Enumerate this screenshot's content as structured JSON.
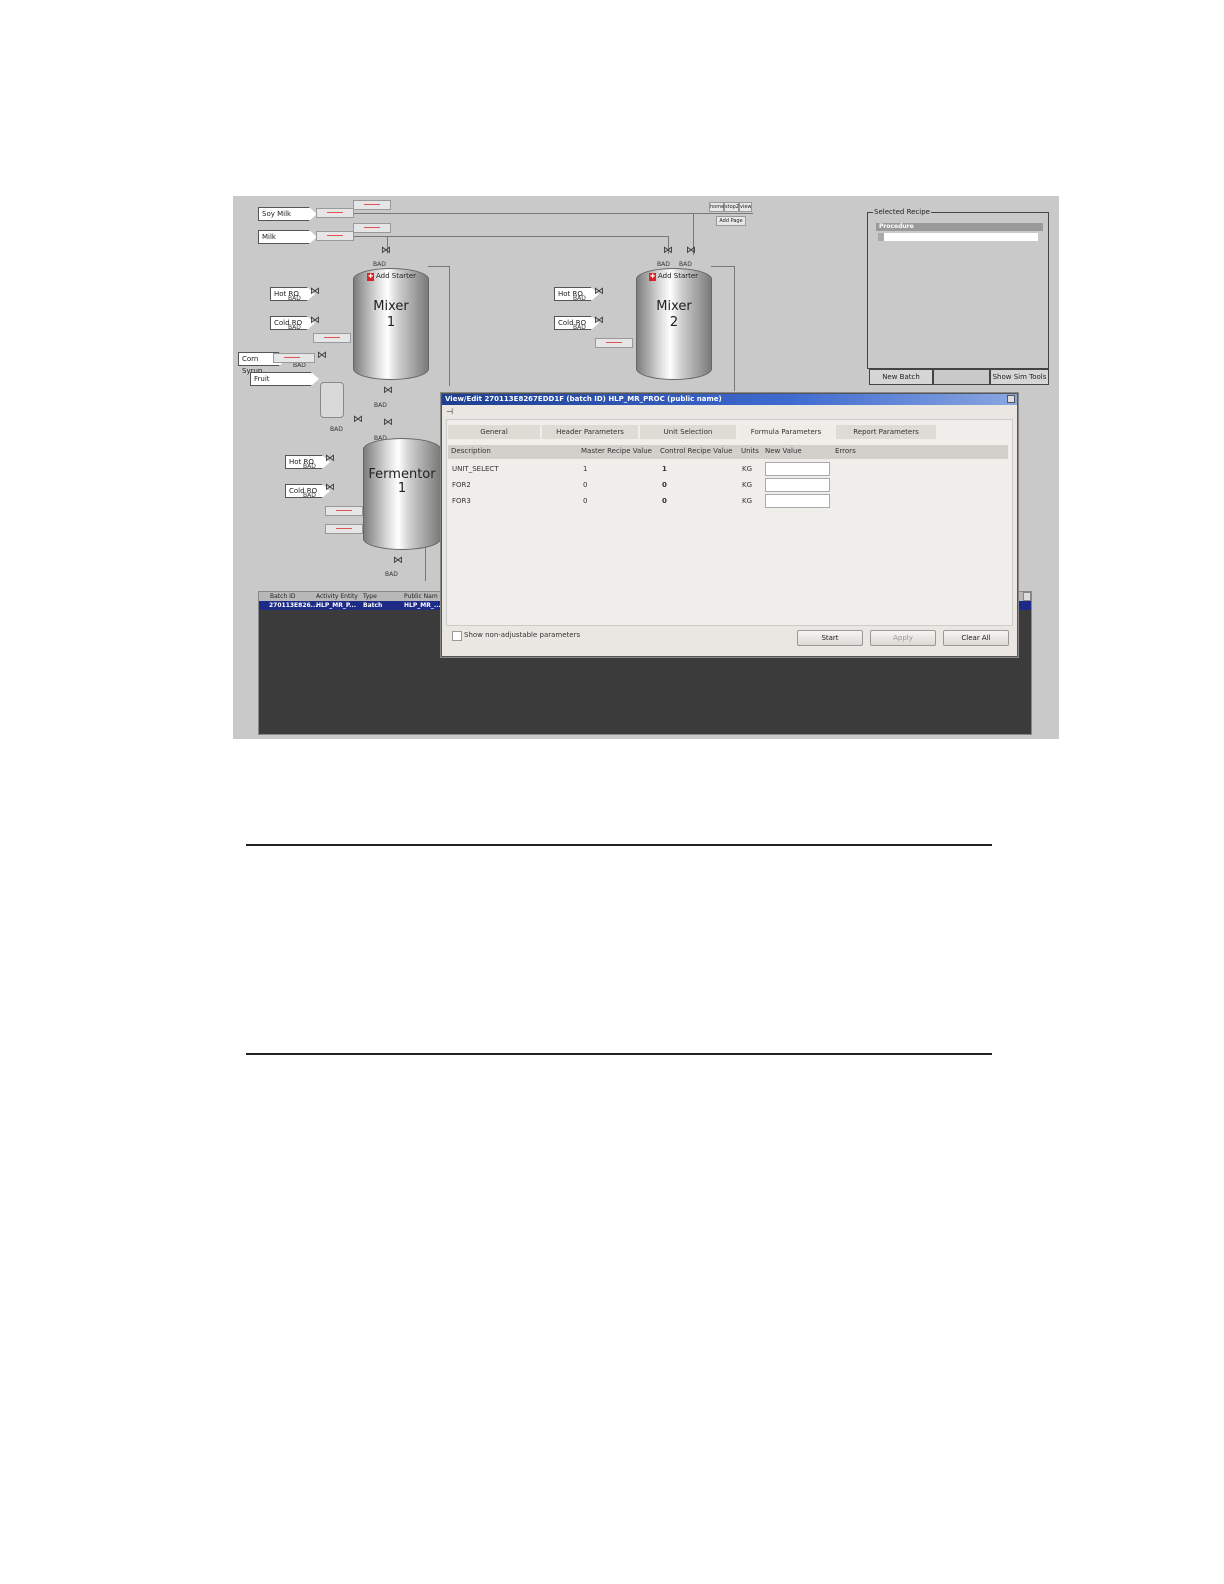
{
  "inputs": {
    "soy_milk": "Soy Milk",
    "milk": "Milk",
    "hot_ro": "Hot RO",
    "cold_ro": "Cold RO",
    "corn_syrup": "Corn Syrup",
    "fruit": "Fruit"
  },
  "status_bad": "BAD",
  "tanks": {
    "mixer1": [
      "Mixer",
      "1"
    ],
    "mixer2": [
      "Mixer",
      "2"
    ],
    "fermentor1": [
      "Fermentor",
      "1"
    ]
  },
  "add_starter": "Add Starter",
  "mini_buttons": [
    "home",
    "stop2",
    "view"
  ],
  "add_page": "Add Page",
  "selected_recipe": {
    "title": "Selected Recipe",
    "procedure": "Procedure"
  },
  "buttons": {
    "new_batch": "New Batch",
    "show_sim_tools": "Show Sim Tools"
  },
  "batch_list": {
    "headers": [
      "Batch ID",
      "Activity Entity",
      "Type",
      "Public Nam"
    ],
    "row": [
      "270113E826...",
      "HLP_MR_P...",
      "Batch",
      "HLP_MR_..."
    ]
  },
  "dialog": {
    "title": "View/Edit 270113E8267EDD1F (batch ID) HLP_MR_PROC (public name)",
    "tabs": [
      "General",
      "Header Parameters",
      "Unit Selection",
      "Formula Parameters",
      "Report Parameters"
    ],
    "active_tab": 3,
    "columns": [
      "Description",
      "Master Recipe Value",
      "Control Recipe Value",
      "Units",
      "New Value",
      "Errors"
    ],
    "rows": [
      {
        "description": "UNIT_SELECT",
        "master": "1",
        "control": "1",
        "units": "KG"
      },
      {
        "description": "FOR2",
        "master": "0",
        "control": "0",
        "units": "KG"
      },
      {
        "description": "FOR3",
        "master": "0",
        "control": "0",
        "units": "KG"
      }
    ],
    "show_non_adjustable": "Show non-adjustable parameters",
    "buttons": {
      "start": "Start",
      "apply": "Apply",
      "clear_all": "Clear All"
    }
  }
}
